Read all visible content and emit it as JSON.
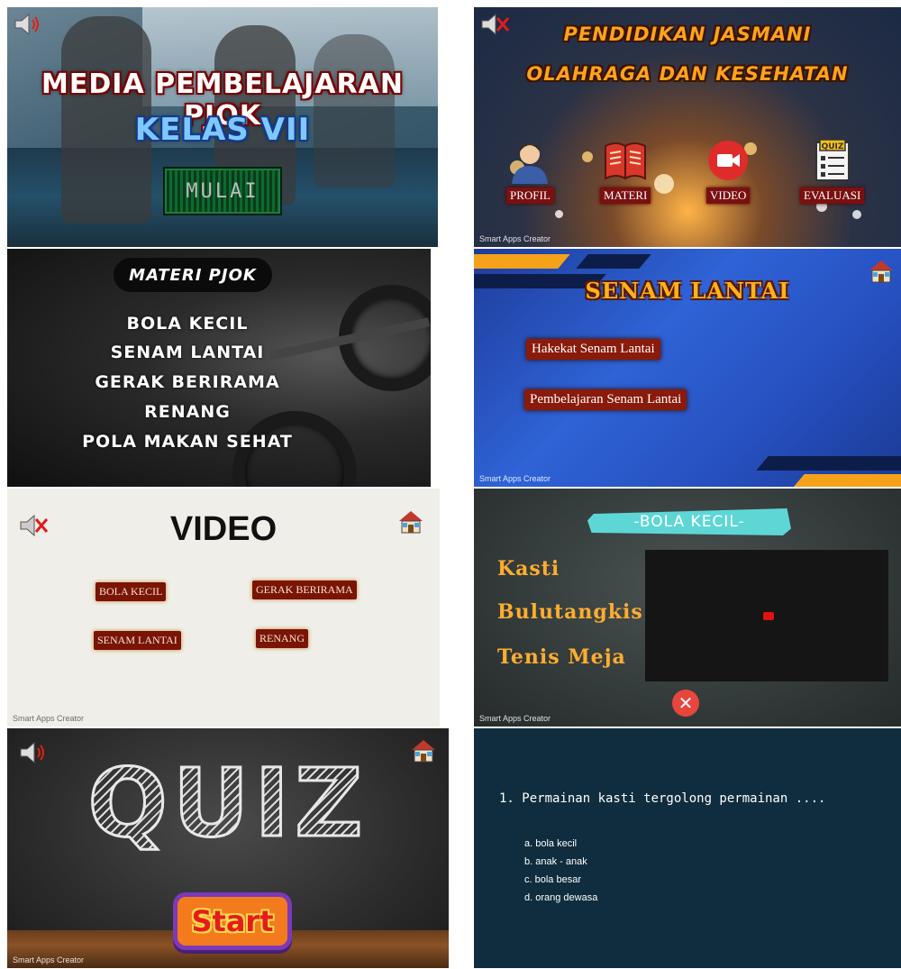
{
  "screen1": {
    "title": "MEDIA PEMBELAJARAN PJOK",
    "subtitle": "KELAS VII",
    "start_label": "MULAI"
  },
  "screen2": {
    "title_line1": "PENDIDIKAN JASMANI",
    "title_line2": "OLAHRAGA DAN KESEHATAN",
    "menu": [
      {
        "label": "PROFIL",
        "icon": "profile-icon"
      },
      {
        "label": "MATERI",
        "icon": "book-icon"
      },
      {
        "label": "VIDEO",
        "icon": "video-camera-icon"
      },
      {
        "label": "EVALUASI",
        "icon": "quiz-icon",
        "icon_text": "QUIZ"
      }
    ],
    "footer": "Smart Apps Creator"
  },
  "screen3": {
    "title": "MATERI PJOK",
    "items": [
      "BOLA KECIL",
      "SENAM LANTAI",
      "GERAK BERIRAMA",
      "RENANG",
      "POLA MAKAN SEHAT"
    ]
  },
  "screen4": {
    "title": "SENAM LANTAI",
    "links": [
      "Hakekat Senam Lantai",
      "Pembelajaran Senam Lantai"
    ],
    "footer": "Smart Apps Creator"
  },
  "screen5": {
    "title": "VIDEO",
    "buttons": [
      "BOLA KECIL",
      "GERAK BERIRAMA",
      "SENAM LANTAI",
      "RENANG"
    ],
    "footer": "Smart Apps Creator"
  },
  "screen6": {
    "title": "-BOLA KECIL-",
    "sports": [
      "Kasti",
      "Bulutangkis",
      "Tenis Meja"
    ],
    "footer": "Smart Apps Creator"
  },
  "screen7": {
    "title": "QUIZ",
    "start_label": "Start",
    "footer": "Smart Apps Creator"
  },
  "screen8": {
    "question": "1. Permainan kasti tergolong permainan ....",
    "options": [
      "a. bola kecil",
      "b. anak - anak",
      "c. bola besar",
      "d. orang dewasa"
    ]
  },
  "colors": {
    "title_orange": "#ffa21c",
    "button_red": "#7a1010",
    "quiz_bg": "#0f2d3e"
  }
}
